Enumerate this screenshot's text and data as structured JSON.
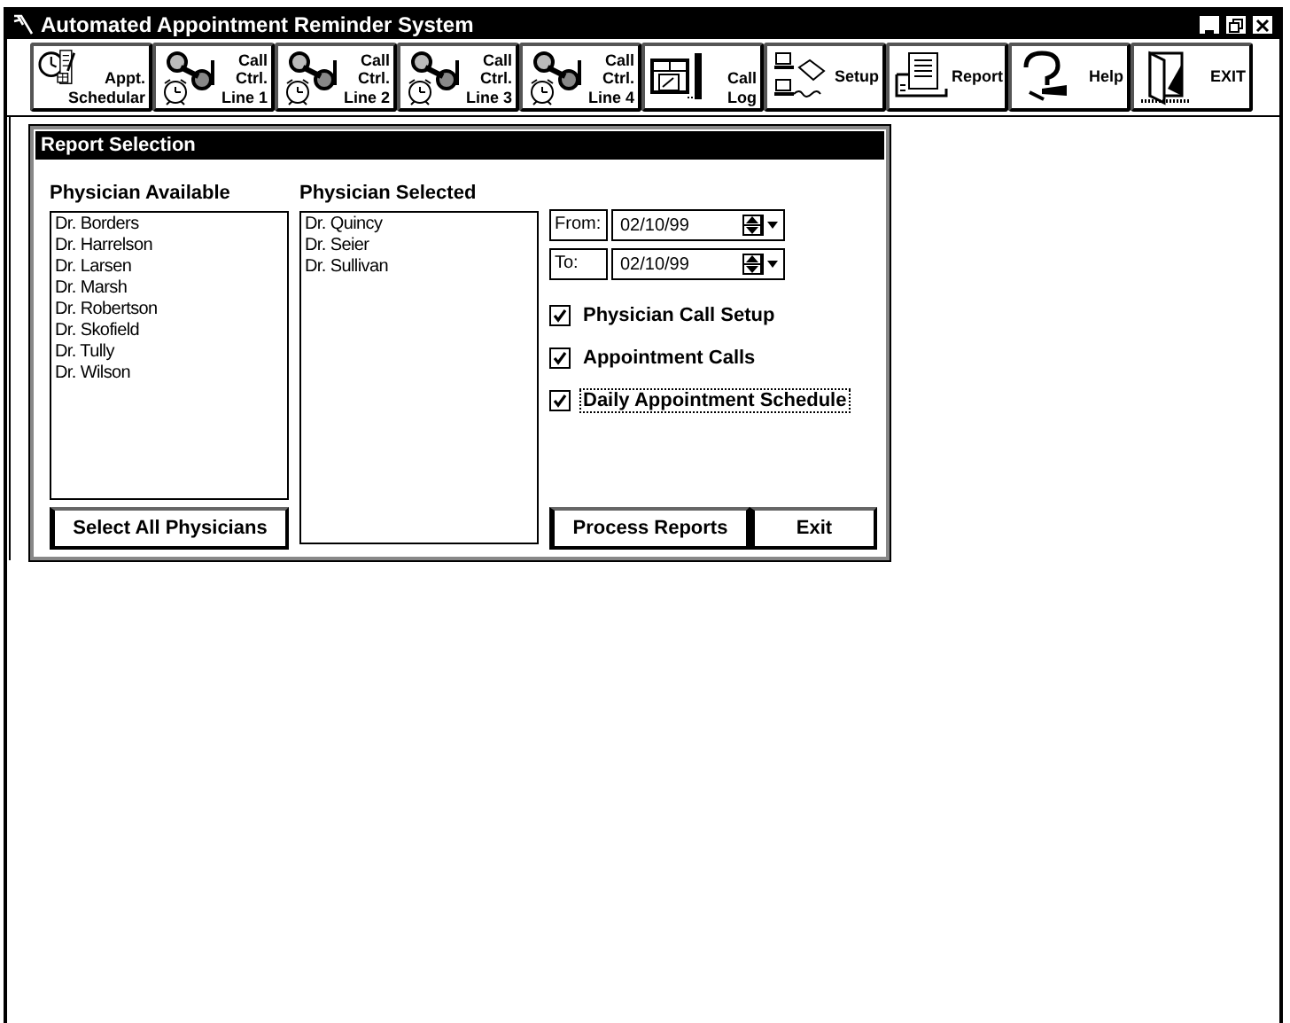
{
  "window": {
    "title": "Automated Appointment Reminder System"
  },
  "toolbar": [
    {
      "kind": "schedule",
      "label": "Appt.\nSchedular"
    },
    {
      "kind": "callctrl",
      "label": "Call\nCtrl.\nLine 1"
    },
    {
      "kind": "callctrl",
      "label": "Call\nCtrl.\nLine 2"
    },
    {
      "kind": "callctrl",
      "label": "Call\nCtrl.\nLine 3"
    },
    {
      "kind": "callctrl",
      "label": "Call\nCtrl.\nLine 4"
    },
    {
      "kind": "calllog",
      "label": "Call\nLog"
    },
    {
      "kind": "setup",
      "label": "Setup"
    },
    {
      "kind": "report",
      "label": "Report"
    },
    {
      "kind": "help",
      "label": "Help"
    },
    {
      "kind": "exit",
      "label": "EXIT"
    }
  ],
  "report_selection": {
    "title": "Report Selection",
    "available": {
      "heading": "Physician Available",
      "items": [
        "Dr. Borders",
        "Dr. Harrelson",
        "Dr. Larsen",
        "Dr. Marsh",
        "Dr. Robertson",
        "Dr. Skofield",
        "Dr. Tully",
        "Dr. Wilson"
      ]
    },
    "selected": {
      "heading": "Physician Selected",
      "items": [
        "Dr. Quincy",
        "Dr. Seier",
        "Dr. Sullivan"
      ]
    },
    "select_all_button": "Select All Physicians",
    "dates": [
      {
        "label": "From:",
        "value": "02/10/99"
      },
      {
        "label": "To:",
        "value": "02/10/99"
      }
    ],
    "reports": [
      {
        "label": "Physician Call Setup",
        "checked": true,
        "focused": false
      },
      {
        "label": "Appointment Calls",
        "checked": true,
        "focused": false
      },
      {
        "label": "Daily Appointment Schedule",
        "checked": true,
        "focused": true
      }
    ],
    "buttons": [
      "Process Reports",
      "Exit"
    ]
  }
}
